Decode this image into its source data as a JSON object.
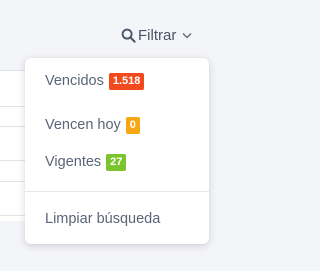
{
  "filter": {
    "label": "Filtrar"
  },
  "menu": {
    "items": [
      {
        "label": "Vencidos",
        "count": "1.518",
        "badge_color": "#f04a1d"
      },
      {
        "label": "Vencen hoy",
        "count": "0",
        "badge_color": "#f5a814"
      },
      {
        "label": "Vigentes",
        "count": "27",
        "badge_color": "#7cc42e"
      }
    ],
    "clear_label": "Limpiar búsqueda"
  }
}
